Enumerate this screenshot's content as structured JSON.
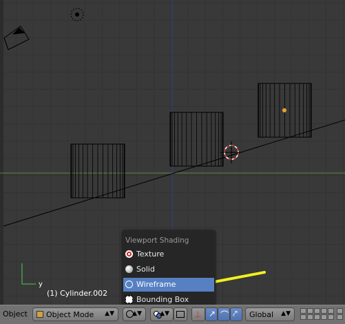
{
  "viewport": {
    "object_label": "(1) Cylinder.002",
    "axis_label": "y"
  },
  "shading_menu": {
    "title": "Viewport Shading",
    "items": [
      {
        "label": "Texture",
        "icon": "texture-icon"
      },
      {
        "label": "Solid",
        "icon": "solid-icon"
      },
      {
        "label": "Wireframe",
        "icon": "wireframe-icon",
        "active": true
      },
      {
        "label": "Bounding Box",
        "icon": "bounding-box-icon"
      }
    ]
  },
  "header": {
    "menu_label": "Object",
    "mode": "Object Mode",
    "orientation": "Global"
  },
  "colors": {
    "active_item": "#5680c2",
    "annotation_arrow": "#f0f020",
    "x_axis": "#5a8a3a",
    "z_axis": "#3a3a8a"
  }
}
